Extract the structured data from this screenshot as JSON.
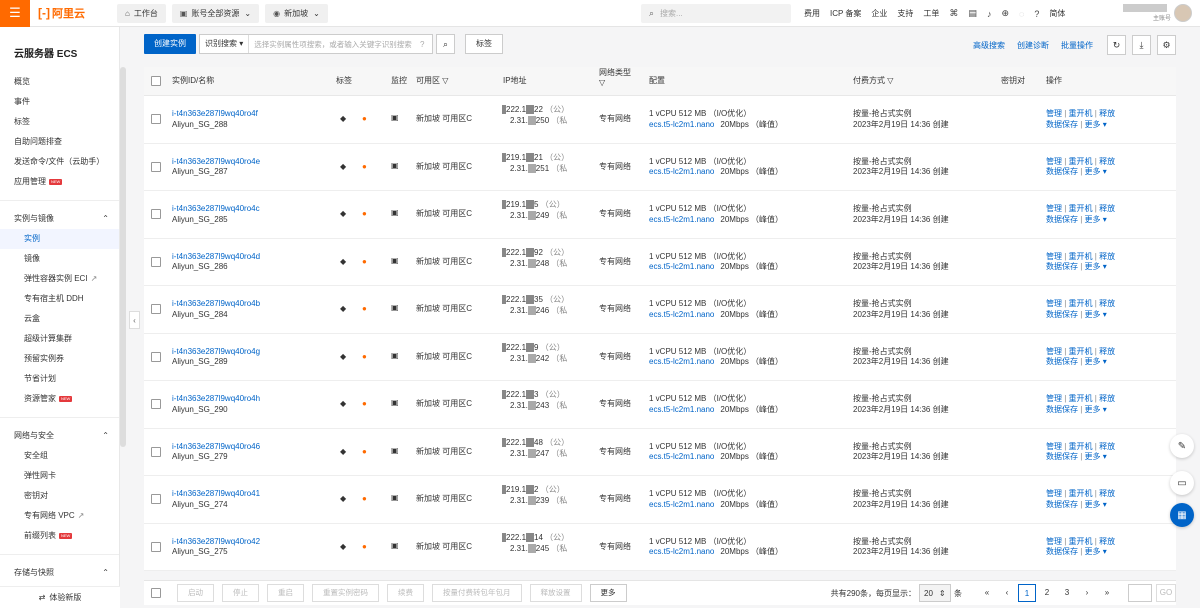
{
  "topbar": {
    "menu_icon": "menu-icon",
    "logo_text": "阿里云",
    "workbench": "工作台",
    "account_scope": "账号全部资源",
    "region": "新加坡",
    "search_placeholder": "搜索...",
    "links": [
      "费用",
      "ICP 备案",
      "企业",
      "支持",
      "工单"
    ],
    "lang": "简体",
    "account_sub": "主账号"
  },
  "sidebar": {
    "title": "云服务器 ECS",
    "items1": [
      "概览",
      "事件",
      "标签",
      "自助问题排查",
      "发送命令/文件（云助手）",
      "应用管理"
    ],
    "group1": "实例与镜像",
    "group1_items": [
      "实例",
      "镜像",
      "弹性容器实例 ECI",
      "专有宿主机 DDH",
      "云盒",
      "超级计算集群",
      "预留实例券",
      "节省计划",
      "资源管家"
    ],
    "group2": "网络与安全",
    "group2_items": [
      "安全组",
      "弹性网卡",
      "密钥对",
      "专有网络 VPC",
      "前缀列表"
    ],
    "group3": "存储与快照",
    "bottom": "体验新版",
    "new_badge": "NEW"
  },
  "toolbar": {
    "create": "创建实例",
    "search_mode": "识别搜索",
    "search_placeholder": "选择实例属性项搜索，或者输入关键字识别搜索",
    "tag_btn": "标签",
    "adv_search": "高级搜索",
    "create_diag": "创建诊断",
    "batch": "批量操作"
  },
  "table": {
    "headers": {
      "id": "实例ID/名称",
      "tag": "标签",
      "monitor": "监控",
      "zone": "可用区",
      "ip": "IP地址",
      "net_type": "网络类型",
      "config": "配置",
      "pay": "付费方式",
      "keypair": "密钥对",
      "ops": "操作"
    },
    "rows": [
      {
        "id": "i-t4n363e287l9wq40ro4f",
        "name": "Aliyun_SG_288",
        "zone": "新加坡 可用区C",
        "ip1": "222.1",
        "ip1b": "22",
        "ip2": "2.31.",
        "ip2b": "250",
        "net": "专有网络",
        "cfg1": "1 vCPU 512 MB （I/O优化）",
        "cfg2": "ecs.t5-lc2m1.nano",
        "bw": "20Mbps （峰值）",
        "pay1": "按量-抢占式实例",
        "pay2": "2023年2月19日 14:36 创建"
      },
      {
        "id": "i-t4n363e287l9wq40ro4e",
        "name": "Aliyun_SG_287",
        "zone": "新加坡 可用区C",
        "ip1": "219.1",
        "ip1b": "21",
        "ip2": "2.31.",
        "ip2b": "251",
        "net": "专有网络",
        "cfg1": "1 vCPU 512 MB （I/O优化）",
        "cfg2": "ecs.t5-lc2m1.nano",
        "bw": "20Mbps （峰值）",
        "pay1": "按量-抢占式实例",
        "pay2": "2023年2月19日 14:36 创建"
      },
      {
        "id": "i-t4n363e287l9wq40ro4c",
        "name": "Aliyun_SG_285",
        "zone": "新加坡 可用区C",
        "ip1": "219.1",
        "ip1b": "5",
        "ip2": "2.31.",
        "ip2b": "249",
        "net": "专有网络",
        "cfg1": "1 vCPU 512 MB （I/O优化）",
        "cfg2": "ecs.t5-lc2m1.nano",
        "bw": "20Mbps （峰值）",
        "pay1": "按量-抢占式实例",
        "pay2": "2023年2月19日 14:36 创建"
      },
      {
        "id": "i-t4n363e287l9wq40ro4d",
        "name": "Aliyun_SG_286",
        "zone": "新加坡 可用区C",
        "ip1": "222.1",
        "ip1b": "92",
        "ip2": "2.31.",
        "ip2b": "248",
        "net": "专有网络",
        "cfg1": "1 vCPU 512 MB （I/O优化）",
        "cfg2": "ecs.t5-lc2m1.nano",
        "bw": "20Mbps （峰值）",
        "pay1": "按量-抢占式实例",
        "pay2": "2023年2月19日 14:36 创建"
      },
      {
        "id": "i-t4n363e287l9wq40ro4b",
        "name": "Aliyun_SG_284",
        "zone": "新加坡 可用区C",
        "ip1": "222.1",
        "ip1b": "35",
        "ip2": "2.31.",
        "ip2b": "246",
        "net": "专有网络",
        "cfg1": "1 vCPU 512 MB （I/O优化）",
        "cfg2": "ecs.t5-lc2m1.nano",
        "bw": "20Mbps （峰值）",
        "pay1": "按量-抢占式实例",
        "pay2": "2023年2月19日 14:36 创建"
      },
      {
        "id": "i-t4n363e287l9wq40ro4g",
        "name": "Aliyun_SG_289",
        "zone": "新加坡 可用区C",
        "ip1": "222.1",
        "ip1b": "9",
        "ip2": "2.31.",
        "ip2b": "242",
        "net": "专有网络",
        "cfg1": "1 vCPU 512 MB （I/O优化）",
        "cfg2": "ecs.t5-lc2m1.nano",
        "bw": "20Mbps （峰值）",
        "pay1": "按量-抢占式实例",
        "pay2": "2023年2月19日 14:36 创建"
      },
      {
        "id": "i-t4n363e287l9wq40ro4h",
        "name": "Aliyun_SG_290",
        "zone": "新加坡 可用区C",
        "ip1": "222.1",
        "ip1b": "3",
        "ip2": "2.31.",
        "ip2b": "243",
        "net": "专有网络",
        "cfg1": "1 vCPU 512 MB （I/O优化）",
        "cfg2": "ecs.t5-lc2m1.nano",
        "bw": "20Mbps （峰值）",
        "pay1": "按量-抢占式实例",
        "pay2": "2023年2月19日 14:36 创建"
      },
      {
        "id": "i-t4n363e287l9wq40ro46",
        "name": "Aliyun_SG_279",
        "zone": "新加坡 可用区C",
        "ip1": "222.1",
        "ip1b": "48",
        "ip2": "2.31.",
        "ip2b": "247",
        "net": "专有网络",
        "cfg1": "1 vCPU 512 MB （I/O优化）",
        "cfg2": "ecs.t5-lc2m1.nano",
        "bw": "20Mbps （峰值）",
        "pay1": "按量-抢占式实例",
        "pay2": "2023年2月19日 14:36 创建"
      },
      {
        "id": "i-t4n363e287l9wq40ro41",
        "name": "Aliyun_SG_274",
        "zone": "新加坡 可用区C",
        "ip1": "219.1",
        "ip1b": "2",
        "ip2": "2.31.",
        "ip2b": "239",
        "net": "专有网络",
        "cfg1": "1 vCPU 512 MB （I/O优化）",
        "cfg2": "ecs.t5-lc2m1.nano",
        "bw": "20Mbps （峰值）",
        "pay1": "按量-抢占式实例",
        "pay2": "2023年2月19日 14:36 创建"
      },
      {
        "id": "i-t4n363e287l9wq40ro42",
        "name": "Aliyun_SG_275",
        "zone": "新加坡 可用区C",
        "ip1": "222.1",
        "ip1b": "14",
        "ip2": "2.31.",
        "ip2b": "245",
        "net": "专有网络",
        "cfg1": "1 vCPU 512 MB （I/O优化）",
        "cfg2": "ecs.t5-lc2m1.nano",
        "bw": "20Mbps （峰值）",
        "pay1": "按量-抢占式实例",
        "pay2": "2023年2月19日 14:36 创建"
      }
    ],
    "ip_pub": "（公）",
    "ip_priv": "（私",
    "ops": {
      "manage": "管理",
      "restart": "重开机",
      "release": "释放",
      "save": "数据保存",
      "more": "更多"
    }
  },
  "footer": {
    "buttons": [
      "启动",
      "停止",
      "重启",
      "重置实例密码",
      "续费",
      "按量付费转包年包月",
      "释放设置",
      "更多"
    ],
    "total": "共有290条，每页显示：",
    "page_size": "20",
    "unit": "条",
    "pages": [
      "1",
      "2",
      "3"
    ],
    "go": "GO"
  },
  "colors": {
    "accent": "#0064c8",
    "brand": "#ff6a00"
  }
}
